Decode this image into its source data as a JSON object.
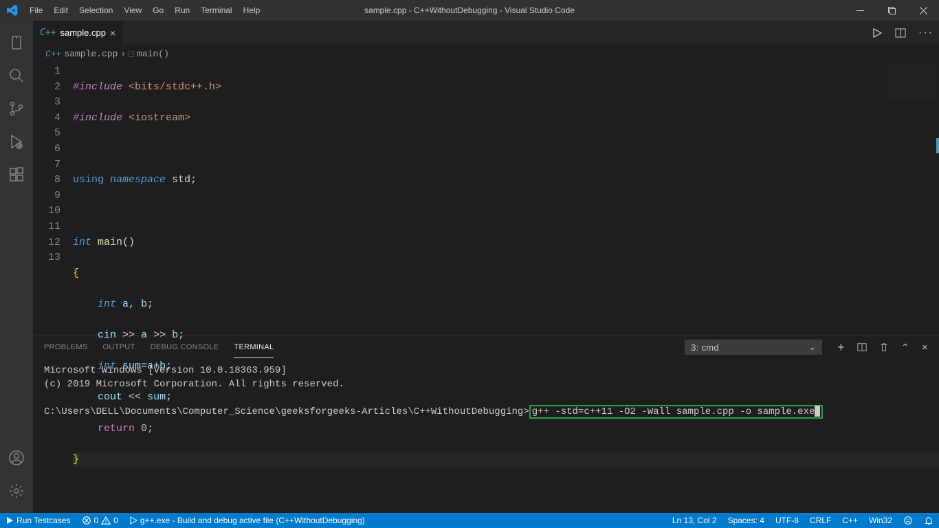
{
  "app": {
    "title": "sample.cpp - C++WithoutDebugging - Visual Studio Code"
  },
  "menu": [
    "File",
    "Edit",
    "Selection",
    "View",
    "Go",
    "Run",
    "Terminal",
    "Help"
  ],
  "tab": {
    "lang_badge": "C++",
    "filename": "sample.cpp"
  },
  "breadcrumb": {
    "lang_badge": "C++",
    "file": "sample.cpp",
    "symbol": "main()"
  },
  "code": {
    "line1_include": "#include",
    "line1_header": "<bits/stdc++.h>",
    "line2_include": "#include",
    "line2_header": "<iostream>",
    "line4_using": "using",
    "line4_namespace": "namespace",
    "line4_std": "std",
    "line6_int": "int",
    "line6_main": "main",
    "line8_int": "int",
    "line8_a": "a",
    "line8_b": "b",
    "line9_cin": "cin",
    "line9_a": "a",
    "line9_b": "b",
    "line10_int": "int",
    "line10_sum": "sum",
    "line10_a": "a",
    "line10_b": "b",
    "line11_cout": "cout",
    "line11_sum": "sum",
    "line12_return": "return",
    "line12_zero": "0"
  },
  "line_numbers": [
    "1",
    "2",
    "3",
    "4",
    "5",
    "6",
    "7",
    "8",
    "9",
    "10",
    "11",
    "12",
    "13"
  ],
  "panel": {
    "tabs": {
      "problems": "PROBLEMS",
      "output": "OUTPUT",
      "debug": "DEBUG CONSOLE",
      "terminal": "TERMINAL"
    },
    "shell_selector": "3: cmd"
  },
  "terminal": {
    "line1": "Microsoft Windows [Version 10.0.18363.959]",
    "line2": "(c) 2019 Microsoft Corporation. All rights reserved.",
    "prompt": "C:\\Users\\DELL\\Documents\\Computer_Science\\geeksforgeeks-Articles\\C++WithoutDebugging>",
    "command": "g++ -std=c++11 -O2 -Wall sample.cpp -o sample.exe"
  },
  "status": {
    "run_testcases": "Run Testcases",
    "err_warn": "0",
    "err_warn2": "0",
    "build": "g++.exe - Build and debug active file (C++WithoutDebugging)",
    "ln_col": "Ln 13, Col 2",
    "spaces": "Spaces: 4",
    "encoding": "UTF-8",
    "eol": "CRLF",
    "language": "C++",
    "platform": "Win32"
  }
}
